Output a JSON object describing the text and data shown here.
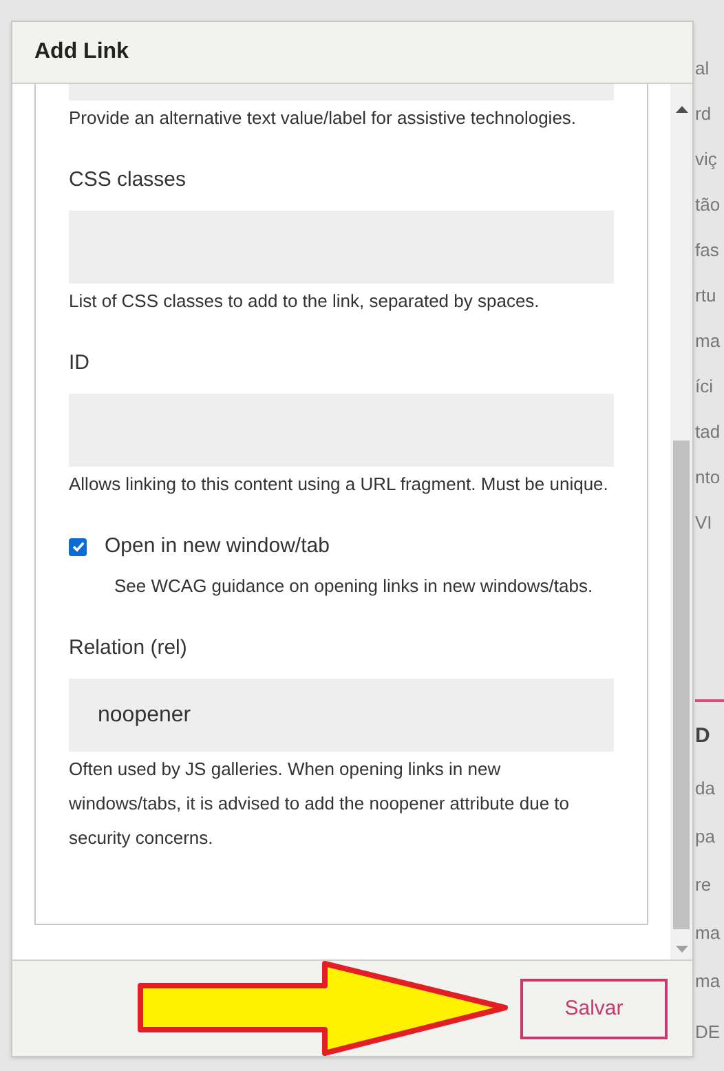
{
  "background": {
    "right_top": [
      "al",
      "rd",
      "viç",
      "tão",
      "fas",
      "rtu",
      "ma",
      "íci",
      "tad",
      "nto",
      "VI"
    ],
    "right_heading": "D",
    "right_bottom": [
      "da",
      "pa",
      "re",
      "ma",
      "ma"
    ],
    "right_footer": "DE"
  },
  "dialog": {
    "title": "Add Link",
    "fields": [
      {
        "kind": "text",
        "cut_off": true,
        "help": "Provide an alternative text value/label for assistive technologies."
      },
      {
        "kind": "text",
        "cut_off": false,
        "label": "CSS classes",
        "help": "List of CSS classes to add to the link, separated by spaces."
      },
      {
        "kind": "text",
        "cut_off": false,
        "label": "ID",
        "help": "Allows linking to this content using a URL fragment. Must be unique."
      },
      {
        "kind": "checkbox",
        "label": "Open in new window/tab",
        "checked": true,
        "help": "See WCAG guidance on opening links in new windows/tabs."
      },
      {
        "kind": "text",
        "cut_off": false,
        "label": "Relation (rel)",
        "value": "noopener",
        "help": "Often used by JS galleries. When opening links in new windows/tabs, it is advised to add the noopener attribute due to security concerns."
      }
    ],
    "buttons": [
      {
        "label": "Salvar"
      }
    ]
  }
}
